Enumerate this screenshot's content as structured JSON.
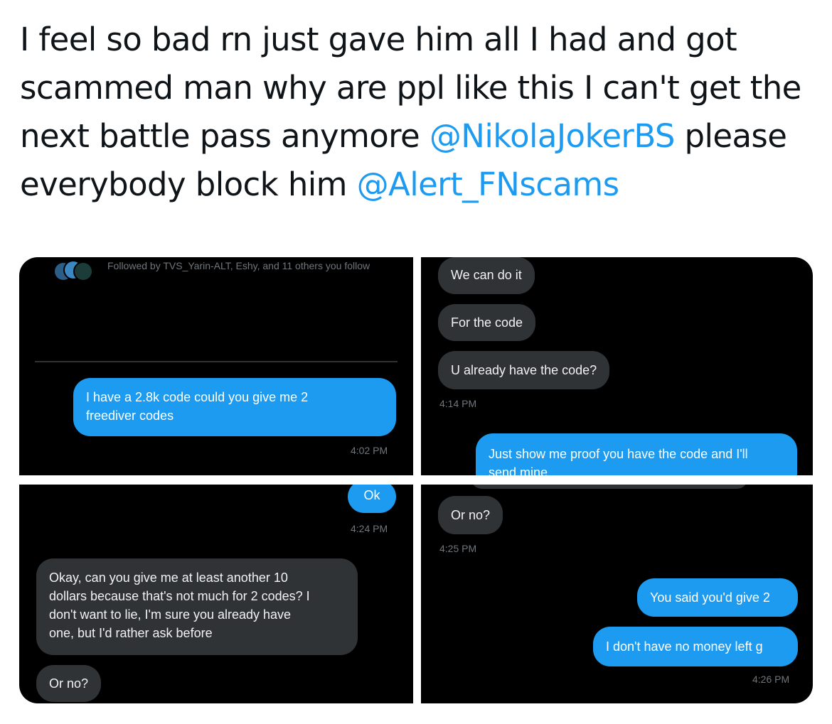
{
  "tweet": {
    "text_parts": {
      "p1": "I feel so bad rn just gave him all I had and got scammed man why are ppl like this I can't get the next battle pass anymore ",
      "mention1": "@NikolaJokerBS",
      "p2": " please everybody block him ",
      "mention2": "@Alert_FNscams"
    }
  },
  "media": {
    "shot1": {
      "followed_by": "Followed by TVS_Yarin-ALT, Eshy, and 11 others you follow",
      "msg_out": "I have a 2.8k code could you give me 2\nfreediver codes",
      "time": "4:02 PM"
    },
    "shot2": {
      "msg1": "We can do it",
      "msg2": "For the code",
      "msg3": "U already have the code?",
      "time": "4:14 PM",
      "msg_out": "Just show me proof you have the code and I'll\nsend mine"
    },
    "shot3": {
      "msg_out": "Ok",
      "time": "4:24 PM",
      "msg_in": "Okay, can you give me at least another 10\ndollars because that's not much for 2 codes? I\ndon't want to lie, I'm sure you already have\none, but I'd rather ask before",
      "msg_in2": "Or no?"
    },
    "shot4": {
      "msg_in": "Or no?",
      "time": "4:25 PM",
      "msg_out1": "You said you'd give 2",
      "msg_out2": "I don't have no money left g",
      "time2": "4:26 PM"
    }
  }
}
